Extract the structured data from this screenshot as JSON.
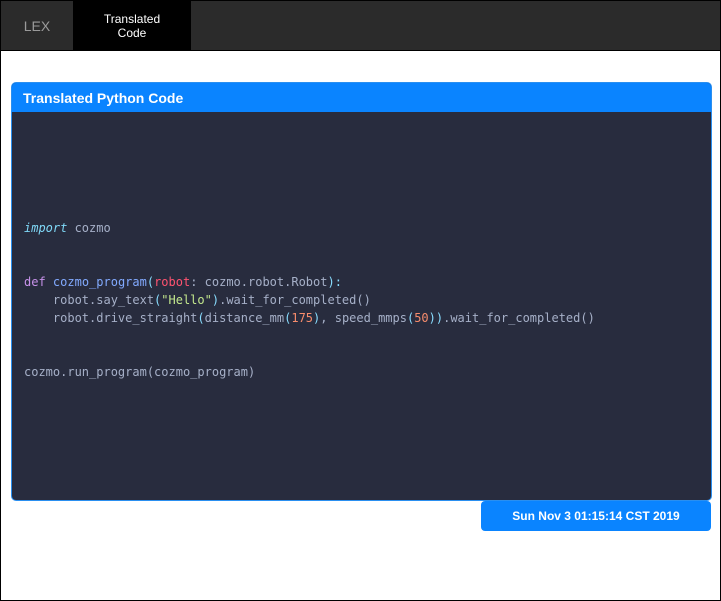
{
  "tabs": {
    "lex_label": "LEX",
    "translated_label_line1": "Translated",
    "translated_label_line2": "Code"
  },
  "panel": {
    "title": "Translated Python Code"
  },
  "code": {
    "import_kw": "import",
    "import_mod": " cozmo",
    "def_kw": "def",
    "func_name": "cozmo_program",
    "param_name": "robot",
    "param_type": ": cozmo.robot.Robot",
    "l2_prefix": "    robot.say_text",
    "l2_string": "\"Hello\"",
    "l2_suffix": ".wait_for_completed()",
    "l3_prefix": "    robot.drive_straight",
    "l3_arg1": "distance_mm",
    "l3_num1": "175",
    "l3_arg2": "speed_mmps",
    "l3_num2": "50",
    "l3_suffix": ".wait_for_completed()",
    "run_line": "cozmo.run_program(cozmo_program)"
  },
  "footer": {
    "timestamp": "Sun Nov  3 01:15:14 CST 2019"
  },
  "colors": {
    "accent": "#0a84ff",
    "code_bg": "#282c3e",
    "topbar_bg": "#2b2b2b"
  }
}
